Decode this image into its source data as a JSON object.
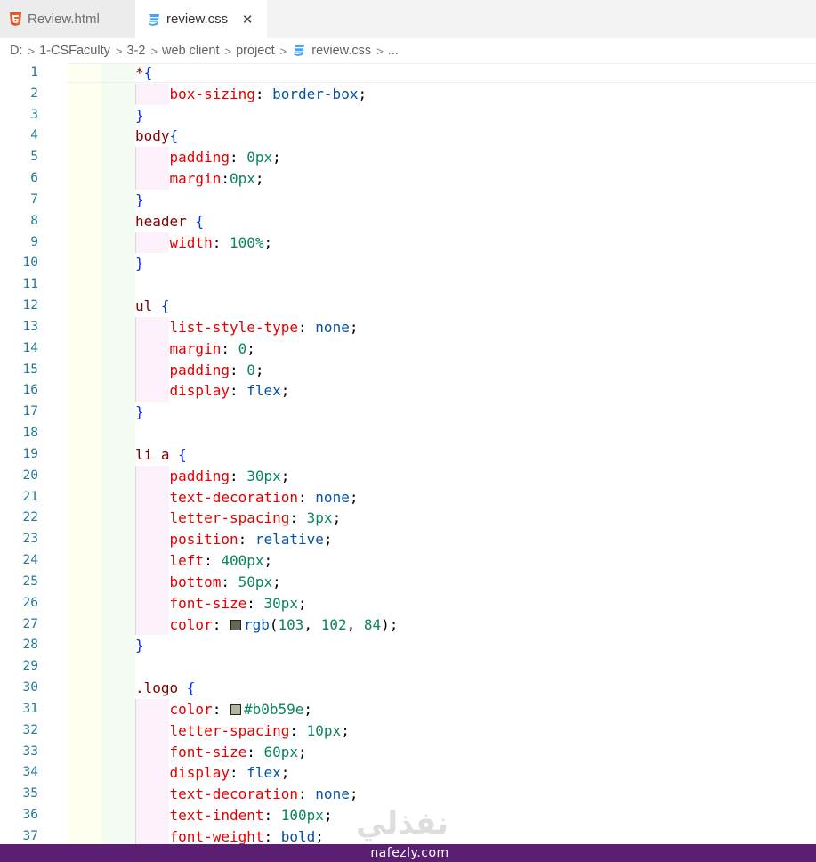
{
  "tabs": [
    {
      "label": "Review.html",
      "icon": "html5-icon",
      "active": false
    },
    {
      "label": "review.css",
      "icon": "css3-icon",
      "active": true
    }
  ],
  "tab_close_glyph": "✕",
  "breadcrumb": {
    "items": [
      "D:",
      "1-CSFaculty",
      "3-2",
      "web client",
      "project"
    ],
    "file": "review.css",
    "ellipsis": "..."
  },
  "colors": {
    "html_icon": "#e44d26",
    "css_icon": "#42a5f5",
    "line_number": "#237893",
    "selector": "#800000",
    "property": "#e50000",
    "value": "#0451a5",
    "number": "#098658",
    "brace": "#0431fa",
    "swatch_1": "#676654",
    "swatch_2": "#b0b59e",
    "footer_bar": "#5a1f73"
  },
  "editor": {
    "line_numbers": [
      "1",
      "2",
      "3",
      "4",
      "5",
      "6",
      "7",
      "8",
      "9",
      "10",
      "11",
      "12",
      "13",
      "14",
      "15",
      "16",
      "17",
      "18",
      "19",
      "20",
      "21",
      "22",
      "23",
      "24",
      "25",
      "26",
      "27",
      "28",
      "29",
      "30",
      "31",
      "32",
      "33",
      "34",
      "35",
      "36",
      "37"
    ]
  },
  "code": [
    {
      "sel": "*",
      "br": "{"
    },
    {
      "prop": "box-sizing",
      "val": "border-box"
    },
    {
      "br": "}"
    },
    {
      "sel": "body",
      "br": "{"
    },
    {
      "prop": "padding",
      "num": "0px"
    },
    {
      "prop": "margin",
      "num": "0px",
      "nospace": true
    },
    {
      "br": "}"
    },
    {
      "sel": "header ",
      "br": "{"
    },
    {
      "prop": "width",
      "num": "100%"
    },
    {
      "br": "}"
    },
    {},
    {
      "sel": "ul ",
      "br": "{"
    },
    {
      "prop": "list-style-type",
      "val": "none"
    },
    {
      "prop": "margin",
      "num": "0"
    },
    {
      "prop": "padding",
      "num": "0"
    },
    {
      "prop": "display",
      "val": "flex"
    },
    {
      "br": "}"
    },
    {},
    {
      "sel": "li a ",
      "br": "{"
    },
    {
      "prop": "padding",
      "num": "30px"
    },
    {
      "prop": "text-decoration",
      "val": "none"
    },
    {
      "prop": "letter-spacing",
      "num": "3px"
    },
    {
      "prop": "position",
      "val": "relative"
    },
    {
      "prop": "left",
      "num": "400px"
    },
    {
      "prop": "bottom",
      "num": "50px"
    },
    {
      "prop": "font-size",
      "num": "30px"
    },
    {
      "prop": "color",
      "rgb": [
        "103",
        "102",
        "84"
      ],
      "swatch": "#676654"
    },
    {
      "br": "}"
    },
    {},
    {
      "sel": ".logo ",
      "br": "{"
    },
    {
      "prop": "color",
      "hex": "#b0b59e",
      "swatch": "#b0b59e"
    },
    {
      "prop": "letter-spacing",
      "num": "10px"
    },
    {
      "prop": "font-size",
      "num": "60px"
    },
    {
      "prop": "display",
      "val": "flex"
    },
    {
      "prop": "text-decoration",
      "val": "none"
    },
    {
      "prop": "text-indent",
      "num": "100px"
    },
    {
      "prop": "font-weight",
      "val": "bold"
    }
  ],
  "watermark": {
    "arabic": "نفذلي",
    "site": "nafezly.com"
  }
}
